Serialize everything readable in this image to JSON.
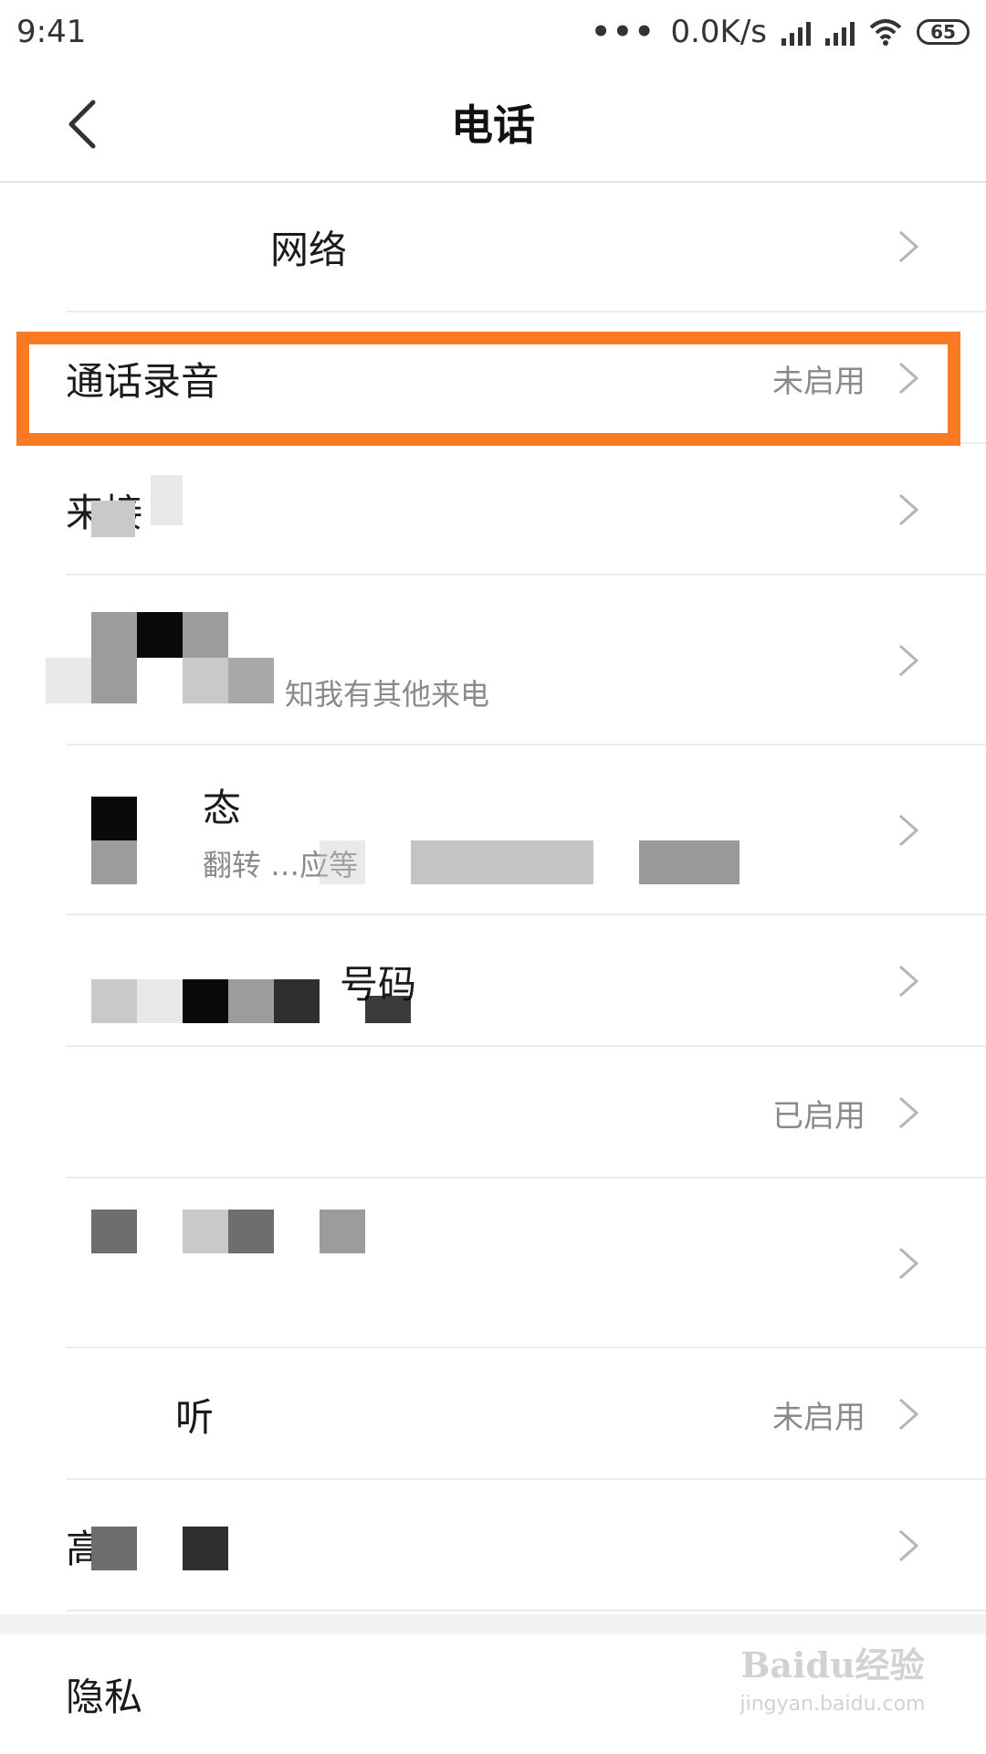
{
  "status_bar": {
    "time": "9:41",
    "network_speed": "0.0K/s",
    "battery": "65",
    "icons": [
      "more-dots-icon",
      "signal-icon",
      "signal-icon",
      "wifi-icon",
      "battery-icon"
    ]
  },
  "header": {
    "title": "电话",
    "back_icon": "chevron-left-icon"
  },
  "settings": [
    {
      "label": "网络",
      "value": "",
      "sub": ""
    },
    {
      "label": "通话录音",
      "value": "未启用",
      "sub": ""
    },
    {
      "label": "来接",
      "value": "",
      "sub": ""
    },
    {
      "label": "",
      "value": "",
      "sub": "知我有其他来电"
    },
    {
      "label": "态",
      "value": "",
      "sub": "翻转 …应等"
    },
    {
      "label": "号码",
      "value": "",
      "sub": ""
    },
    {
      "label": "",
      "value": "已启用",
      "sub": ""
    },
    {
      "label": "",
      "value": "",
      "sub": ""
    },
    {
      "label": "听",
      "value": "未启用",
      "sub": ""
    },
    {
      "label": "高",
      "value": "",
      "sub": ""
    }
  ],
  "bottom": {
    "label": "隐私"
  },
  "watermark": {
    "brand": "Baidu经验",
    "url": "jingyan.baidu.com"
  },
  "colors": {
    "highlight": "#f97a22",
    "divider": "#ececec",
    "secondary_text": "#8a8a8a"
  }
}
